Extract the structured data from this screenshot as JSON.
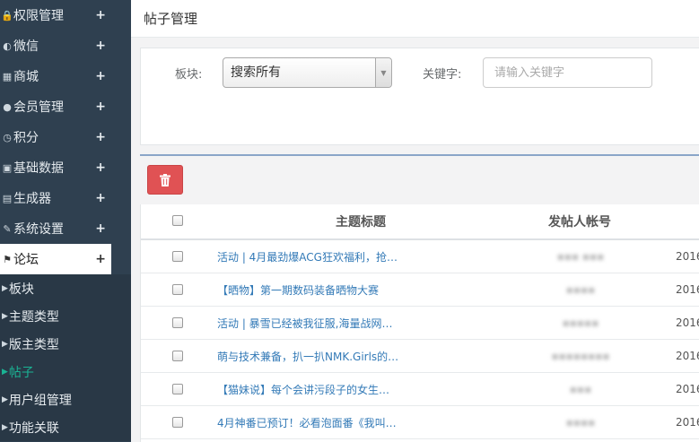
{
  "sidebar": {
    "items": [
      {
        "label": "权限管理",
        "icon": "lock-icon",
        "glyph": "🔒"
      },
      {
        "label": "微信",
        "icon": "wechat-icon",
        "glyph": "◐"
      },
      {
        "label": "商城",
        "icon": "shop-icon",
        "glyph": "▦"
      },
      {
        "label": "会员管理",
        "icon": "user-icon",
        "glyph": "●"
      },
      {
        "label": "积分",
        "icon": "clock-icon",
        "glyph": "◷"
      },
      {
        "label": "基础数据",
        "icon": "data-icon",
        "glyph": "▣"
      },
      {
        "label": "生成器",
        "icon": "file-icon",
        "glyph": "▤"
      },
      {
        "label": "系统设置",
        "icon": "wrench-icon",
        "glyph": "✎"
      },
      {
        "label": "论坛",
        "icon": "forum-icon",
        "glyph": "⚑",
        "active": true
      }
    ],
    "plus": "+",
    "subitems": [
      {
        "label": "板块"
      },
      {
        "label": "主题类型"
      },
      {
        "label": "版主类型"
      },
      {
        "label": "帖子",
        "current": true
      },
      {
        "label": "用户组管理"
      },
      {
        "label": "功能关联"
      }
    ],
    "arrow": "▶"
  },
  "header": {
    "title": "帖子管理"
  },
  "filter": {
    "board_label": "板块:",
    "board_value": "搜索所有",
    "keyword_label": "关键字:",
    "keyword_placeholder": "请输入关键字"
  },
  "colors": {
    "delete_button": "#e05254",
    "link": "#337ab7",
    "sidebar": "#2f4050",
    "current_sub": "#1ab394"
  },
  "table": {
    "headers": {
      "title": "主题标题",
      "user": "发帖人帐号"
    },
    "rows": [
      {
        "title": "活动 | 4月最劲爆ACG狂欢福利，抢…",
        "user": "▪▪▪ ▪▪▪",
        "date": "2016"
      },
      {
        "title": "【晒物】第一期数码装备晒物大赛",
        "user": "▪▪▪▪",
        "date": "2016"
      },
      {
        "title": "活动 | 暴雪已经被我征服,海量战网…",
        "user": "▪▪▪▪▪",
        "date": "2016"
      },
      {
        "title": "萌与技术兼备，扒一扒NMK.Girls的…",
        "user": "▪▪▪▪▪▪▪▪",
        "date": "2016"
      },
      {
        "title": "【猫妹说】每个会讲污段子的女生…",
        "user": "▪▪▪",
        "date": "2016"
      },
      {
        "title": "4月神番已预订！必看泡面番《我叫…",
        "user": "▪▪▪▪",
        "date": "2016"
      }
    ]
  }
}
